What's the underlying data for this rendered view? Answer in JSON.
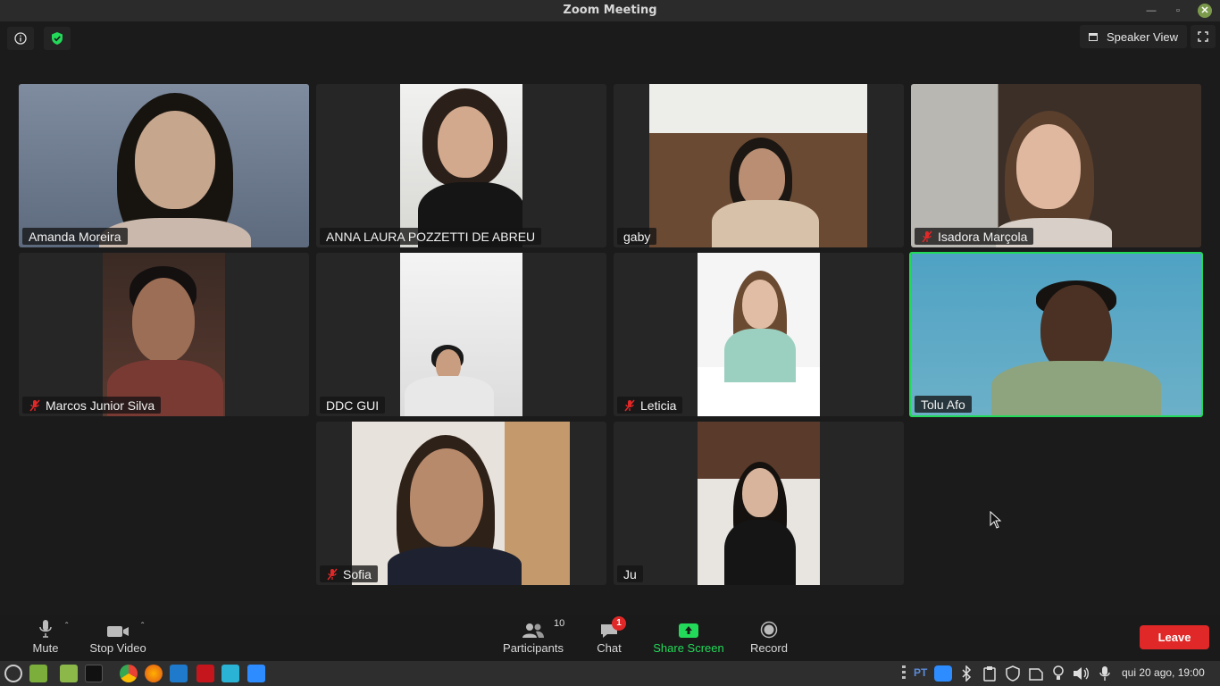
{
  "window": {
    "title": "Zoom Meeting"
  },
  "top_bar": {
    "speaker_view_label": "Speaker View"
  },
  "participants": [
    {
      "name": "Amanda Moreira",
      "muted": false,
      "active_speaker": false
    },
    {
      "name": "ANNA LAURA POZZETTI DE ABREU",
      "muted": false,
      "active_speaker": false
    },
    {
      "name": "gaby",
      "muted": false,
      "active_speaker": false
    },
    {
      "name": "Isadora Marçola",
      "muted": true,
      "active_speaker": false
    },
    {
      "name": "Marcos Junior Silva",
      "muted": true,
      "active_speaker": false
    },
    {
      "name": "DDC GUI",
      "muted": false,
      "active_speaker": false
    },
    {
      "name": "Leticia",
      "muted": true,
      "active_speaker": false
    },
    {
      "name": "Tolu Afo",
      "muted": false,
      "active_speaker": true
    },
    {
      "name": "Sofia",
      "muted": true,
      "active_speaker": false
    },
    {
      "name": "Ju",
      "muted": false,
      "active_speaker": false
    }
  ],
  "toolbar": {
    "mute_label": "Mute",
    "stop_video_label": "Stop Video",
    "participants_label": "Participants",
    "participants_count": "10",
    "chat_label": "Chat",
    "chat_badge": "1",
    "share_screen_label": "Share Screen",
    "record_label": "Record",
    "leave_label": "Leave"
  },
  "taskbar": {
    "keyboard_layout": "PT",
    "clock": "qui 20 ago, 19:00"
  },
  "colors": {
    "active_speaker_border": "#23d959",
    "share_screen_green": "#23d959",
    "leave_red": "#e02828",
    "muted_red": "#e02828"
  }
}
